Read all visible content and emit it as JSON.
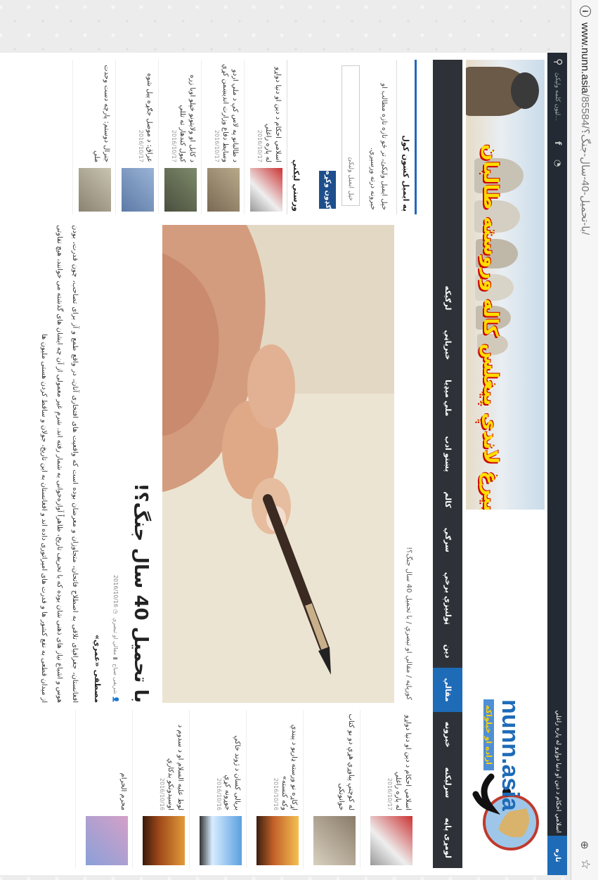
{
  "browser": {
    "url_domain": "www.nunn.asia",
    "url_path": "/85584/با-تحمیل-40-سال-جنگ؟/",
    "info_icon": "info-icon",
    "zoom_icon": "zoom-icon",
    "star_icon": "bookmark-star-icon"
  },
  "topbar": {
    "search_placeholder": "لټون كلمه ولیكئ...",
    "ticker": "اسلامي احکام د دین او دنیا دواړو له پاره راغلي",
    "latest_label": "تازه مطالب"
  },
  "header": {
    "banner_text": "تر بیرغ لاندې پیغلس کاله وروسته طالبان",
    "logo_name": "nunn.asia",
    "logo_tagline": "ازاده او خپلواکه"
  },
  "nav": {
    "items": [
      "لومړی پاڼه",
      "سرلیکنه",
      "خبرونه",
      "مقالې",
      "دین",
      "ټولنیزې برخې",
      "سرګي",
      "کالم",
      "پښتو ادب",
      "ملي میډیا",
      "خبرپاڼې",
      "لرګيکه"
    ],
    "active_index": 3
  },
  "newsletter": {
    "title": "په ایمیل کښون کول",
    "description": "خپل ایمیل ولیکئ، تر څو تازه تازه مطالب او خبرونه درته ورسېږي.",
    "placeholder": "خپل ایمیل ولیکئ",
    "button": "ګډون وکړه"
  },
  "left_list": {
    "title": "ورستي لیکنې",
    "items": [
      {
        "title": "اسلامي احکام د دین او دنیا دواړو له پاره راغلي",
        "date": "2016/10/17"
      },
      {
        "title": "د طالبانو په لاس کې د ملي اردو وسایط دفاع وزارت اندیښمن کړي",
        "date": "2016/10/17"
      },
      {
        "title": "د کابل او ولایتونو خپلو اوبا زره کيول کندهار ته تللي",
        "date": "2016/10/17"
      },
      {
        "title": "عراق: د موصل جګړه پیل شوه",
        "date": "2016/10/17"
      },
      {
        "title": "جنرال دوستم: پارچه دست وحدت ملي",
        "date": ""
      }
    ]
  },
  "article": {
    "breadcrumb": "کورپاڼه / مقالې او تبصرې / با تحمیل 40 سال جنگ؟!",
    "title": "با تحمیل 40 سال جنگ؟!",
    "meta_author": "شریفی صباح",
    "meta_category": "مقالې او تبصرې",
    "meta_date": "2016/10/16",
    "author": "مصطفی «عمري»",
    "body": "افغانستان، جغرافیای تلاقی به اصطلاح فاتحان، متجاوزان و معرضان بوده است که واقعیت های افتخاری آنان، در واقع طمع و آز برای تصاحب، چون قدرت، بودن هوس و اشباع نیاز های ذهنی شان بوده که با تحریف تاریخ، ظاهراً آوازه‌خوانی به شمار رفته اند. شرمِ غیر معمولی از آن چه ایشان های گذشته می خوانند، هیچ تفاوتی از میدان قطعی به نفع کشور ها و قدرت های امپراتوری داده اند و افغانستان به این تاریخ، جولان و ساقط کردن هستی ملیون ها"
  },
  "right_list": {
    "items": [
      {
        "title": "اسلامي احکام د دین او دنیا دواړو له پاره راغلي",
        "date": "2016/10/17"
      },
      {
        "title": "له کوچنې پیاوړي هړې دو بو کتاب خوانونکی",
        "date": ""
      },
      {
        "title": "اړکاړه نو ورسته ډاریو د پیندې وکه کنسته»",
        "date": "2016/10/16"
      },
      {
        "title": "بریالی کسان د ژوند خاکې جوړونه کړې",
        "date": "2016/10/16"
      },
      {
        "title": "لوط علیه السلام او د سدوم د اوسیدونکو بدکاري",
        "date": "2016/10/16"
      },
      {
        "title": "محرم الحرام",
        "date": ""
      }
    ]
  }
}
